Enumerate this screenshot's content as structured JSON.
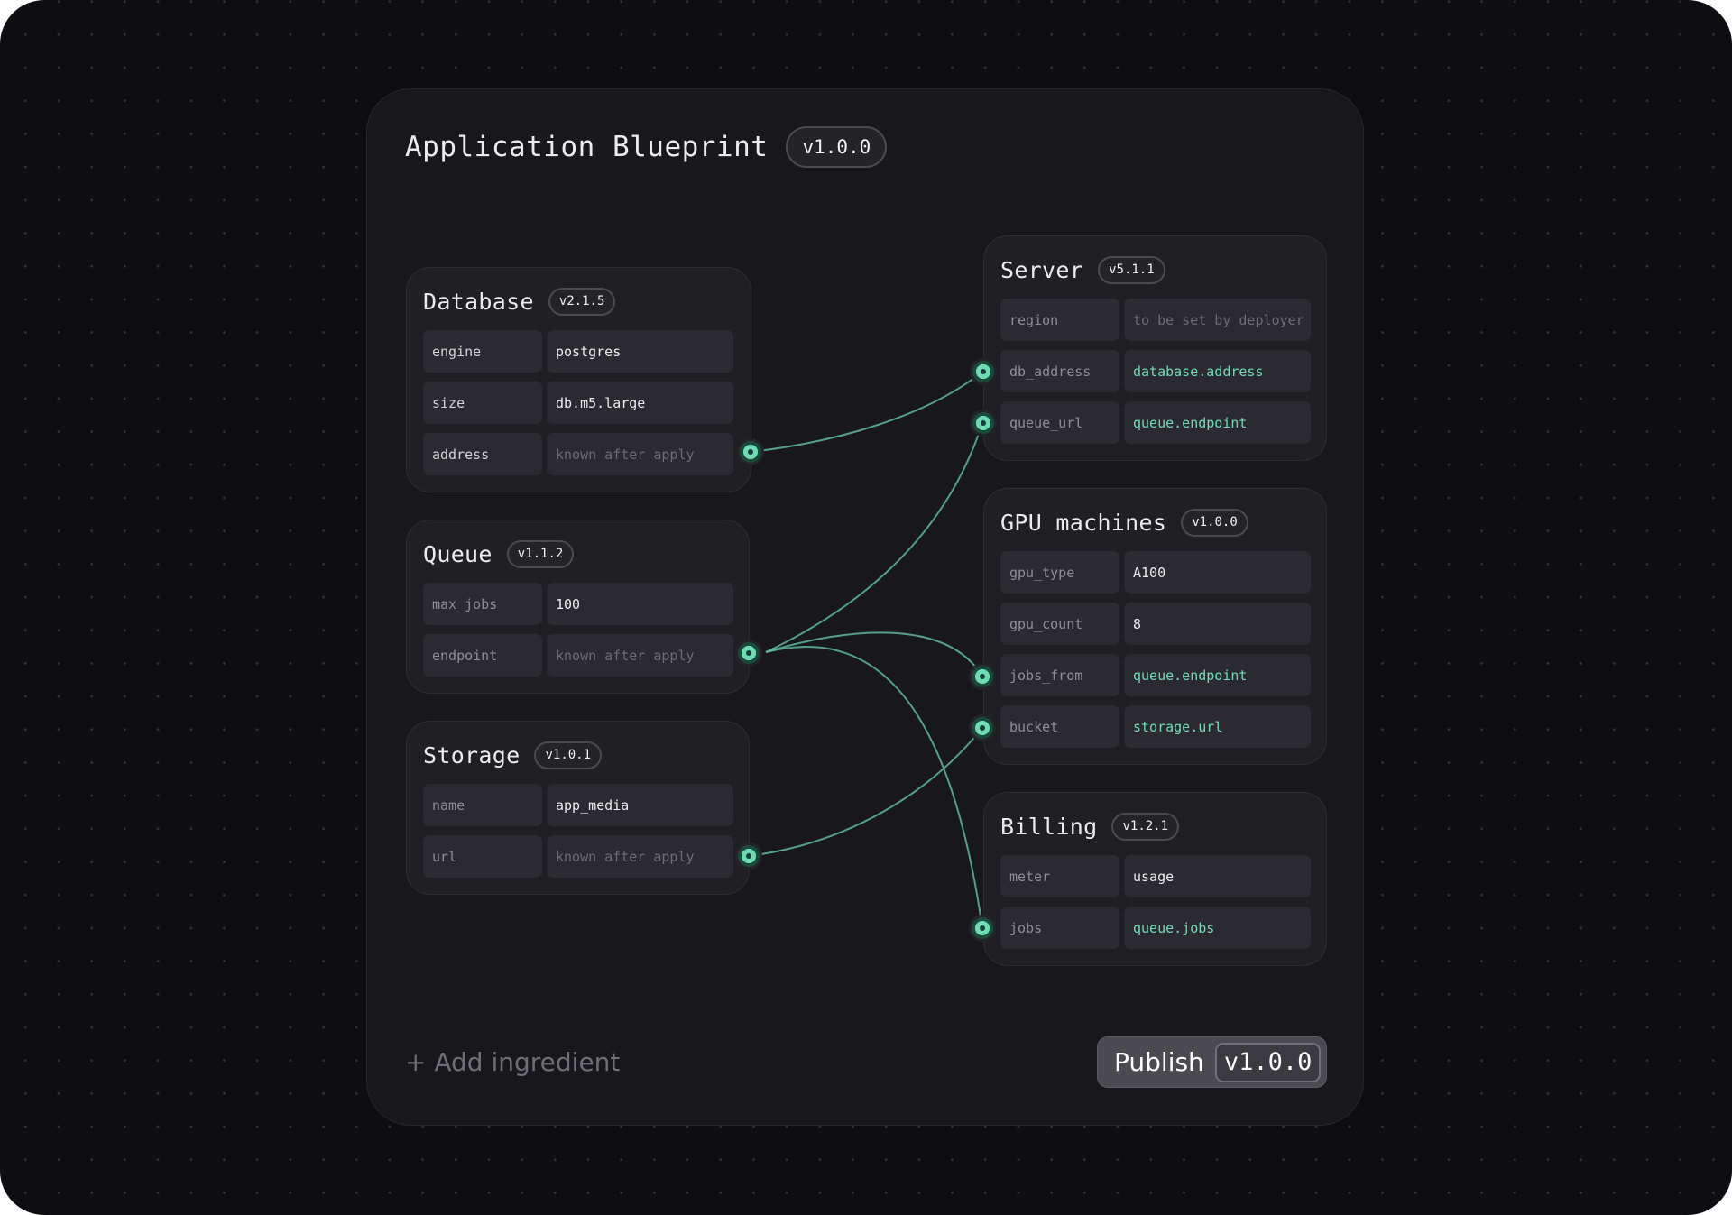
{
  "blueprint": {
    "title": "Application Blueprint",
    "version": "v1.0.0"
  },
  "cards": {
    "database": {
      "title": "Database",
      "version": "v2.1.5",
      "rows": [
        {
          "key": "engine",
          "value": "postgres"
        },
        {
          "key": "size",
          "value": "db.m5.large"
        },
        {
          "key": "address",
          "value": "known after apply"
        }
      ]
    },
    "queue": {
      "title": "Queue",
      "version": "v1.1.2",
      "rows": [
        {
          "key": "max_jobs",
          "value": "100"
        },
        {
          "key": "endpoint",
          "value": "known after apply"
        }
      ]
    },
    "storage": {
      "title": "Storage",
      "version": "v1.0.1",
      "rows": [
        {
          "key": "name",
          "value": "app_media"
        },
        {
          "key": "url",
          "value": "known after apply"
        }
      ]
    },
    "server": {
      "title": "Server",
      "version": "v5.1.1",
      "rows": [
        {
          "key": "region",
          "value": "to be set by deployer"
        },
        {
          "key": "db_address",
          "value": "database.address"
        },
        {
          "key": "queue_url",
          "value": "queue.endpoint"
        }
      ]
    },
    "gpu": {
      "title": "GPU machines",
      "version": "v1.0.0",
      "rows": [
        {
          "key": "gpu_type",
          "value": "A100"
        },
        {
          "key": "gpu_count",
          "value": "8"
        },
        {
          "key": "jobs_from",
          "value": "queue.endpoint"
        },
        {
          "key": "bucket",
          "value": "storage.url"
        }
      ]
    },
    "billing": {
      "title": "Billing",
      "version": "v1.2.1",
      "rows": [
        {
          "key": "meter",
          "value": "usage"
        },
        {
          "key": "jobs",
          "value": "queue.jobs"
        }
      ]
    }
  },
  "actions": {
    "add_label": "+ Add ingredient",
    "publish_label": "Publish",
    "publish_version": "v1.0.0"
  },
  "colors": {
    "background": "#0e0e12",
    "panel": "#18181c",
    "card": "#1f1f24",
    "accent": "#6fdcb6",
    "publish_button": "#4a4a50"
  }
}
